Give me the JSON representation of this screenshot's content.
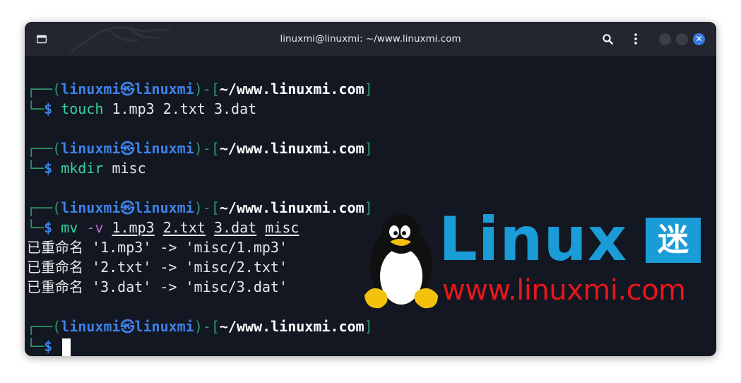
{
  "window": {
    "title": "linuxmi@linuxmi: ~/www.linuxmi.com"
  },
  "titlebar_icons": [
    "new-tab-icon",
    "kali-dragon-icon",
    "search-icon",
    "kebab-menu-icon",
    "minimize-icon",
    "maximize-icon",
    "close-icon"
  ],
  "prompt": {
    "open_bracket": "┌──(",
    "user": "linuxmi",
    "at_symbol": "㉿",
    "host": "linuxmi",
    "mid": ")-[",
    "path": "~/www.linuxmi.com",
    "close_bracket": "]",
    "line2_prefix": "└─",
    "dollar": "$"
  },
  "commands": [
    {
      "cmd": "touch",
      "args": " 1.mp3 2.txt 3.dat"
    },
    {
      "cmd": "mkdir",
      "args": " misc"
    },
    {
      "cmd": "mv",
      "flag": "-v",
      "args": [
        "1.mp3",
        "2.txt",
        "3.dat",
        "misc"
      ]
    }
  ],
  "output": [
    "已重命名 '1.mp3' -> 'misc/1.mp3'",
    "已重命名 '2.txt' -> 'misc/2.txt'",
    "已重命名 '3.dat' -> 'misc/3.dat'"
  ],
  "watermark": {
    "logo_word": "Linux",
    "logo_badge": "迷",
    "url": "www.linuxmi.com"
  },
  "colors": {
    "terminal_bg": "#121722",
    "titlebar_bg": "#232630",
    "prompt_green": "#2e9a6c",
    "prompt_blue": "#3e82e6",
    "command_green": "#3ad19a",
    "flag_purple": "#b56bd4",
    "watermark_blue": "#1a9cd6",
    "watermark_red": "#e8161b"
  }
}
